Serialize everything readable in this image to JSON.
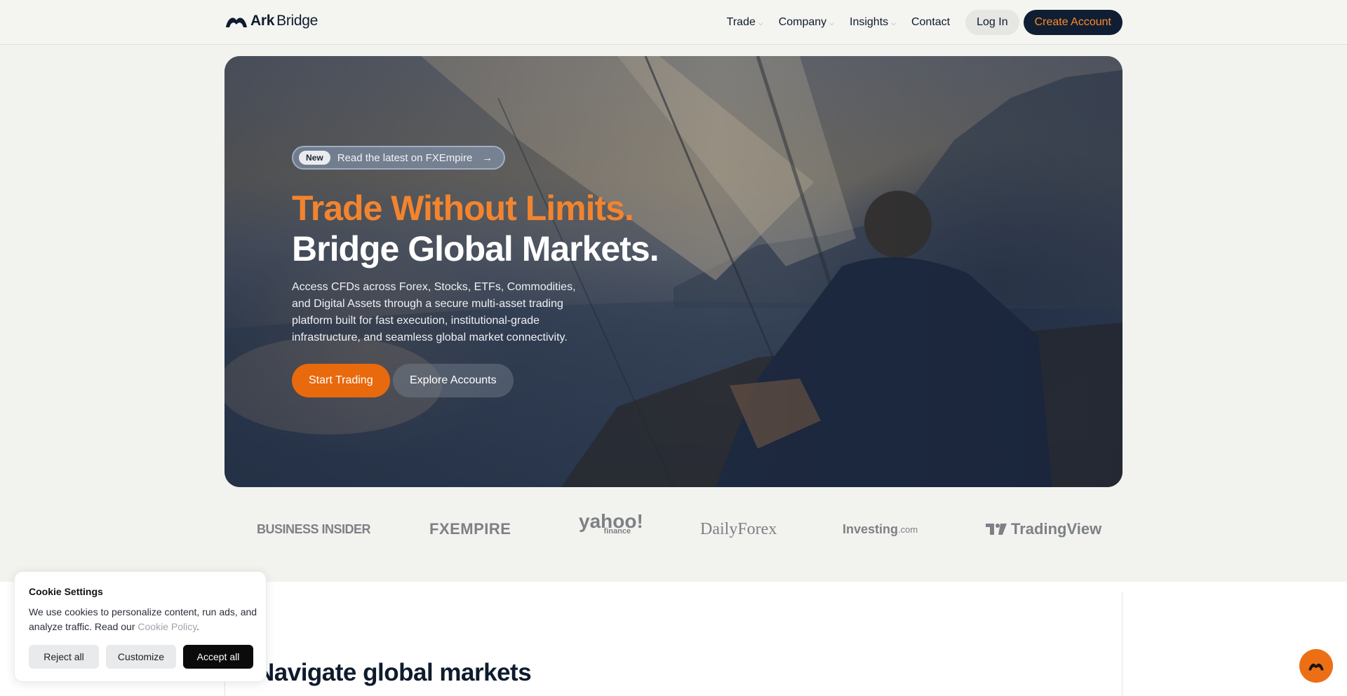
{
  "brand": {
    "name_part1": "Ark",
    "name_part2": "Bridge"
  },
  "nav": {
    "items": [
      {
        "label": "Trade",
        "has_dropdown": true
      },
      {
        "label": "Company",
        "has_dropdown": true
      },
      {
        "label": "Insights",
        "has_dropdown": true
      },
      {
        "label": "Contact",
        "has_dropdown": false
      }
    ],
    "login_label": "Log In",
    "create_account_label": "Create Account"
  },
  "hero": {
    "badge_tag": "New",
    "badge_text": "Read the latest on FXEmpire",
    "badge_arrow": "→",
    "headline_line1": "Trade Without Limits.",
    "headline_line2": "Bridge Global Markets.",
    "description": "Access CFDs across Forex, Stocks, ETFs, Commodities, and Digital Assets through a secure multi-asset trading platform built for fast execution, institutional-grade infrastructure, and seamless global market connectivity.",
    "primary_cta": "Start Trading",
    "secondary_cta": "Explore Accounts"
  },
  "press_logos": {
    "business_insider": "BUSINESS INSIDER",
    "fxempire": "FXEMPIRE",
    "yahoo": "yahoo!",
    "yahoo_sub": "finance",
    "dailyforex": "DailyForex",
    "investing": "Investing",
    "investing_suffix": ".com",
    "tradingview": "TradingView"
  },
  "section": {
    "title": "Navigate global markets"
  },
  "cookie": {
    "title": "Cookie Settings",
    "text": "We use cookies to personalize content, run ads, and analyze traffic. Read our ",
    "link": "Cookie Policy",
    "after_link": ".",
    "reject_label": "Reject all",
    "customize_label": "Customize",
    "accept_label": "Accept all"
  },
  "colors": {
    "accent_orange": "#e9690d",
    "navy": "#0f1e33",
    "background": "#f2f3ee"
  },
  "icons": {
    "logo": "ark-logo-icon",
    "chevron": "chevron-down-icon",
    "arrow": "arrow-right-icon",
    "chat": "support-chat-icon"
  }
}
